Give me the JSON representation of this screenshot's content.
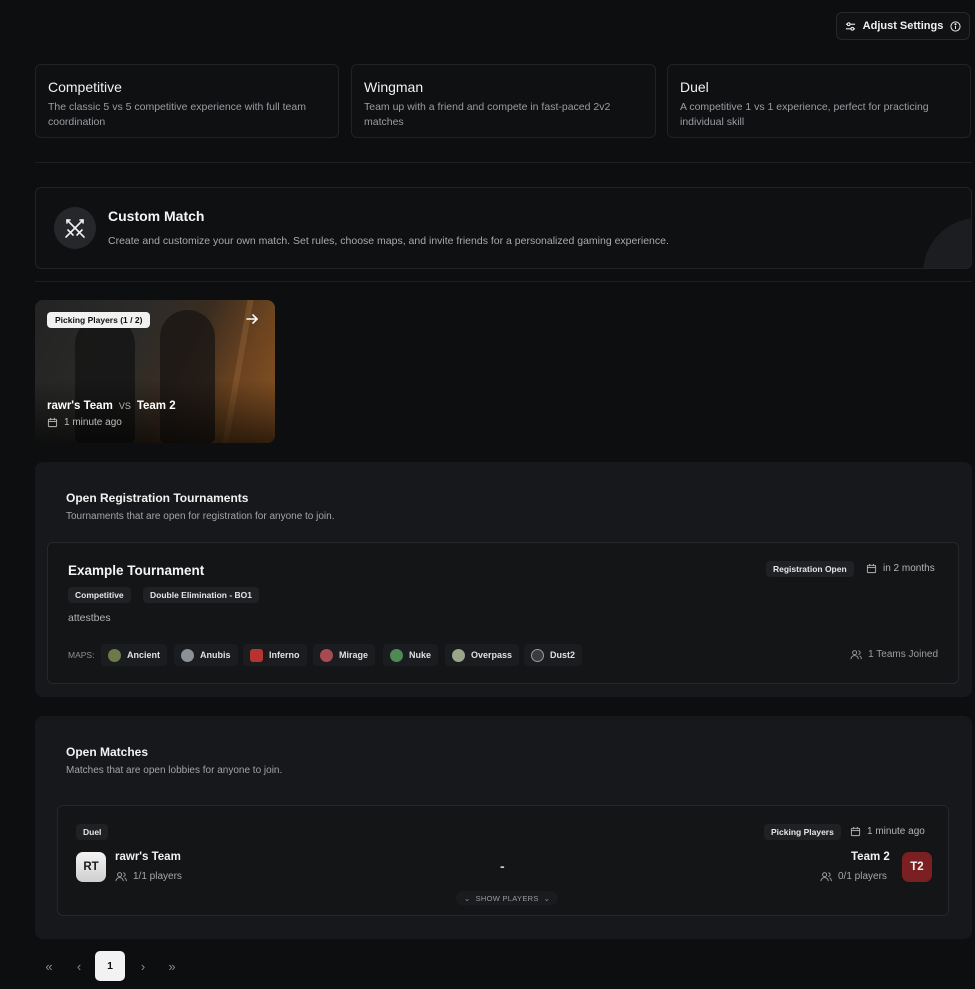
{
  "header": {
    "adjust_settings_label": "Adjust Settings"
  },
  "modes": [
    {
      "title": "Competitive",
      "description": "The classic 5 vs 5 competitive experience with full team coordination"
    },
    {
      "title": "Wingman",
      "description": "Team up with a friend and compete in fast-paced 2v2 matches"
    },
    {
      "title": "Duel",
      "description": "A competitive 1 vs 1 experience, perfect for practicing individual skill"
    }
  ],
  "custom_match": {
    "title": "Custom Match",
    "description": "Create and customize your own match. Set rules, choose maps, and invite friends for a personalized gaming experience."
  },
  "lobby": {
    "badge": "Picking Players (1 / 2)",
    "team1": "rawr's Team",
    "vs": "VS",
    "team2": "Team 2",
    "time": "1 minute ago"
  },
  "tournaments": {
    "title": "Open Registration Tournaments",
    "description": "Tournaments that are open for registration for anyone to join.",
    "card": {
      "name": "Example Tournament",
      "status": "Registration Open",
      "starts": "in 2 months",
      "tags": [
        "Competitive",
        "Double Elimination - BO1"
      ],
      "description": "attestbes",
      "maps_label": "MAPS:",
      "maps": [
        "Ancient",
        "Anubis",
        "Inferno",
        "Mirage",
        "Nuke",
        "Overpass",
        "Dust2"
      ],
      "teams_joined": "1 Teams Joined"
    }
  },
  "open_matches": {
    "title": "Open Matches",
    "description": "Matches that are open lobbies for anyone to join.",
    "match": {
      "mode": "Duel",
      "status": "Picking Players",
      "time": "1 minute ago",
      "team1": {
        "initials": "RT",
        "name": "rawr's Team",
        "players": "1/1 players"
      },
      "separator": "-",
      "team2": {
        "initials": "T2",
        "name": "Team 2",
        "players": "0/1 players"
      },
      "show_players_label": "SHOW PLAYERS"
    }
  },
  "pagination": {
    "first": "«",
    "prev": "‹",
    "current": "1",
    "next": "›",
    "last": "»"
  },
  "colors": {
    "background": "#0d0e10",
    "panel": "#17181b",
    "team2_avatar": "#7a1f22"
  }
}
